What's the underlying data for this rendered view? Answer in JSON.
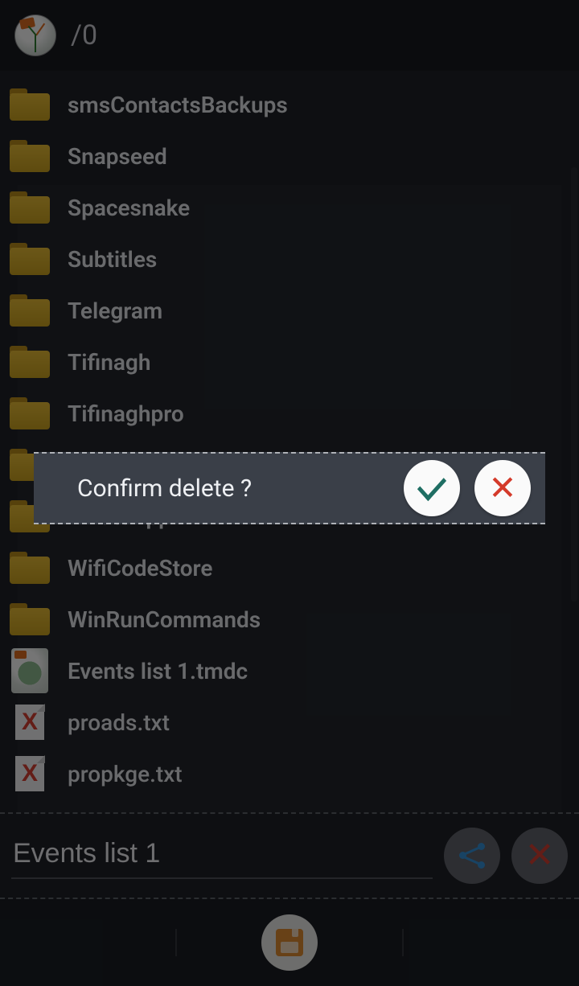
{
  "header": {
    "path": "/0"
  },
  "files": [
    {
      "name": "smsContactsBackups",
      "kind": "folder"
    },
    {
      "name": "Snapseed",
      "kind": "folder"
    },
    {
      "name": "Spacesnake",
      "kind": "folder"
    },
    {
      "name": "Subtitles",
      "kind": "folder"
    },
    {
      "name": "Telegram",
      "kind": "folder"
    },
    {
      "name": "Tifinagh",
      "kind": "folder"
    },
    {
      "name": "Tifinaghpro",
      "kind": "folder"
    },
    {
      "name": "",
      "kind": "folder"
    },
    {
      "name": "WhatsApp",
      "kind": "folder"
    },
    {
      "name": "WifiCodeStore",
      "kind": "folder"
    },
    {
      "name": "WinRunCommands",
      "kind": "folder"
    },
    {
      "name": "Events list 1.tmdc",
      "kind": "tmdc"
    },
    {
      "name": "proads.txt",
      "kind": "txt"
    },
    {
      "name": "propkge.txt",
      "kind": "txt"
    }
  ],
  "input": {
    "filename": "Events list 1"
  },
  "dialog": {
    "message": "Confirm delete ?"
  },
  "icons": {
    "share": "share-icon",
    "delete": "x-icon",
    "save": "floppy-icon",
    "confirm": "check-icon",
    "cancel": "x-icon"
  }
}
